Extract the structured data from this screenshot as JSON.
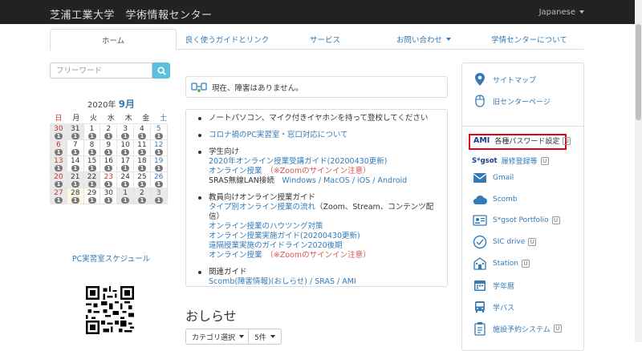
{
  "header": {
    "site_title": "芝浦工業大学　学術情報センター",
    "language": "Japanese"
  },
  "nav": {
    "tabs": [
      {
        "label": "ホーム",
        "active": true,
        "dropdown": false
      },
      {
        "label": "良く使うガイドとリンク",
        "active": false,
        "dropdown": false
      },
      {
        "label": "サービス",
        "active": false,
        "dropdown": false
      },
      {
        "label": "お問い合わせ",
        "active": false,
        "dropdown": true
      },
      {
        "label": "学情センターについて",
        "active": false,
        "dropdown": false
      }
    ]
  },
  "search": {
    "placeholder": "フリーワード",
    "icon": "search-icon"
  },
  "calendar": {
    "year_label": "2020年",
    "month_label": "9月",
    "weekdays": [
      "日",
      "月",
      "火",
      "水",
      "木",
      "金",
      "土"
    ],
    "weeks": [
      [
        {
          "d": "30",
          "b": "1",
          "g": true
        },
        {
          "d": "31",
          "b": "1",
          "g": true
        },
        {
          "d": "1",
          "b": "1"
        },
        {
          "d": "2",
          "b": "1"
        },
        {
          "d": "3",
          "b": "1"
        },
        {
          "d": "4",
          "b": "1"
        },
        {
          "d": "5",
          "b": "1"
        }
      ],
      [
        {
          "d": "6",
          "b": "1",
          "g": true
        },
        {
          "d": "7",
          "b": "1"
        },
        {
          "d": "8",
          "b": "1"
        },
        {
          "d": "9",
          "b": "1"
        },
        {
          "d": "10",
          "b": "1"
        },
        {
          "d": "11",
          "b": "1"
        },
        {
          "d": "12",
          "b": "1"
        }
      ],
      [
        {
          "d": "13",
          "b": "1",
          "g": true
        },
        {
          "d": "14",
          "b": "1"
        },
        {
          "d": "15",
          "b": "1"
        },
        {
          "d": "16",
          "b": "1"
        },
        {
          "d": "17",
          "b": "1"
        },
        {
          "d": "18",
          "b": "1"
        },
        {
          "d": "19",
          "b": "1"
        }
      ],
      [
        {
          "d": "20",
          "b": "1",
          "g": true
        },
        {
          "d": "21",
          "b": "1",
          "g": true
        },
        {
          "d": "22",
          "b": "1",
          "g": true
        },
        {
          "d": "23",
          "b": "1"
        },
        {
          "d": "24",
          "b": "1"
        },
        {
          "d": "25",
          "b": "1"
        },
        {
          "d": "26",
          "b": "1"
        }
      ],
      [
        {
          "d": "27",
          "b": "1",
          "g": true
        },
        {
          "d": "28",
          "b": "1",
          "today": true
        },
        {
          "d": "29",
          "b": "1"
        },
        {
          "d": "30",
          "b": "1"
        },
        {
          "d": "1",
          "b": "1",
          "g": true
        },
        {
          "d": "2",
          "b": "1",
          "g": true
        },
        {
          "d": "3",
          "b": "1",
          "g": true
        }
      ]
    ],
    "schedule_link": "PC実習室スケジュール"
  },
  "notice": {
    "text": "現在、障害はありません。",
    "icon": "status-icon"
  },
  "main": {
    "item1": "ノートパソコン、マイク付きイヤホンを持って登校してください",
    "item2": "コロナ禍のPC実習室・窓口対応について",
    "item3_title": "学生向け",
    "item3_l1": "2020年オンライン授業受講ガイド(20200430更新)",
    "item3_l2a": "オンライン授業",
    "item3_l2b": "（※Zoomのサインイン注意）",
    "item3_l3a": "SRAS無線LAN接続",
    "item3_l3b": "Windows / MacOS / iOS / Android",
    "item4_title": "教員向けオンライン授業ガイド",
    "item4_l1a": "タイプ別オンライン授業の流れ",
    "item4_l1b": "（Zoom、Stream、コンテンツ配信）",
    "item4_l2": "オンライン授業のハウツング対策",
    "item4_l3": "オンライン授業実施ガイド(20200430更新)",
    "item4_l4": "遠隔授業実施のガイドライン2020後期",
    "item4_l5a": "オンライン授業",
    "item4_l5b": "（※Zoomのサインイン注意）",
    "item5_title": "関連ガイド",
    "item5_l1": "Scomb(障害情報)(おしらせ) / SRAS / AMI"
  },
  "news": {
    "heading": "おしらせ",
    "category_select": "カテゴリ選択",
    "count_select": "5件"
  },
  "sidebar": {
    "sitemap": "サイトマップ",
    "old_center": "旧センターページ",
    "ami_logo": "AMI",
    "ami_label": "各種パスワード設定",
    "sgot_logo": "S*gsot",
    "sgot_label": "履修登録等",
    "gmail": "Gmail",
    "scomb": "Scomb",
    "portfolio": "S*gsot Portfolio",
    "sic_drive": "SIC drive",
    "station": "Station",
    "calendar": "学年暦",
    "bus": "学バス",
    "facility": "施設予約システム",
    "u_mark": "U"
  },
  "colors": {
    "accent": "#337ab7",
    "highlight_box": "#e0001a",
    "search_button": "#5bc0de",
    "topbar": "#222222"
  }
}
